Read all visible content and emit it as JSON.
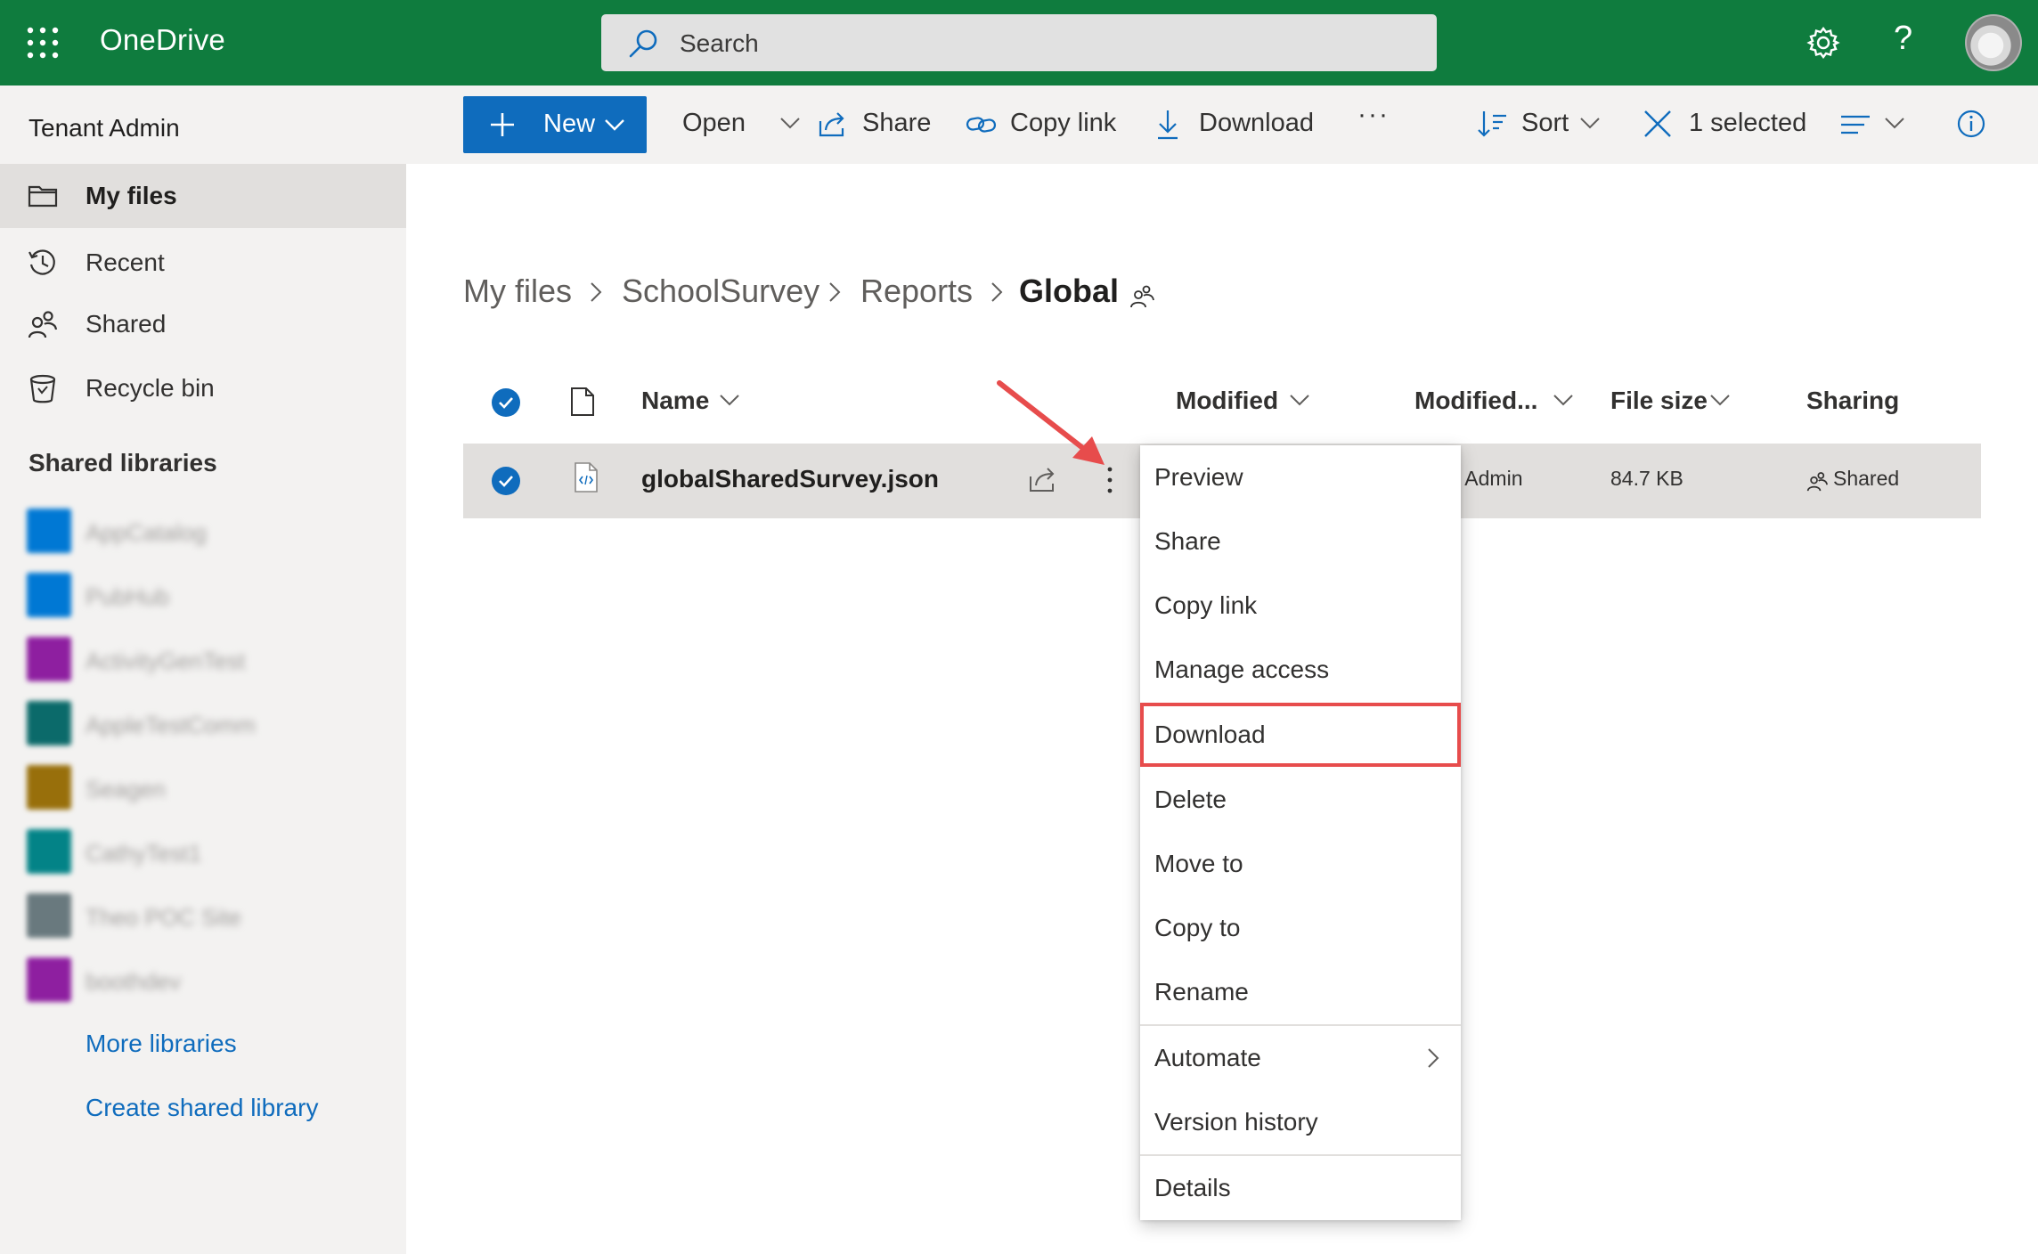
{
  "suite": {
    "app_name": "OneDrive",
    "search_placeholder": "Search"
  },
  "nav": {
    "tenant": "Tenant Admin",
    "items": [
      {
        "label": "My files",
        "icon": "folder-icon",
        "selected": true
      },
      {
        "label": "Recent",
        "icon": "clock-icon",
        "selected": false
      },
      {
        "label": "Shared",
        "icon": "people-icon",
        "selected": false
      },
      {
        "label": "Recycle bin",
        "icon": "trash-icon",
        "selected": false
      }
    ],
    "shared_libraries_heading": "Shared libraries",
    "libraries": [
      {
        "label": "AppCatalog",
        "color": "#0078d4"
      },
      {
        "label": "PubHub",
        "color": "#0078d4"
      },
      {
        "label": "ActivityGenTest",
        "color": "#8e1fa0"
      },
      {
        "label": "AppleTestComm",
        "color": "#0b6a6a"
      },
      {
        "label": "Seagen",
        "color": "#986f0b"
      },
      {
        "label": "CathyTest1",
        "color": "#038387"
      },
      {
        "label": "Theo POC Site",
        "color": "#69797e"
      },
      {
        "label": "boothdev",
        "color": "#8e1fa0"
      }
    ],
    "more_libraries": "More libraries",
    "create_library": "Create shared library"
  },
  "commands": {
    "new": "New",
    "open": "Open",
    "share": "Share",
    "copy_link": "Copy link",
    "download": "Download",
    "more": "···",
    "sort": "Sort",
    "selected": "1 selected"
  },
  "breadcrumb": [
    "My files",
    "SchoolSurvey",
    "Reports",
    "Global"
  ],
  "columns": {
    "name": "Name",
    "modified": "Modified",
    "modified_by": "Modified...",
    "file_size": "File size",
    "sharing": "Sharing"
  },
  "file": {
    "name": "globalSharedSurvey.json",
    "modified_by": "nt Admin",
    "size": "84.7 KB",
    "sharing": "Shared"
  },
  "context_menu": {
    "items": [
      "Preview",
      "Share",
      "Copy link",
      "Manage access",
      "Download",
      "Delete",
      "Move to",
      "Copy to",
      "Rename",
      "Automate",
      "Version history",
      "Details"
    ],
    "highlighted": "Download"
  },
  "colors": {
    "suite_bar": "#0f7c3e",
    "accent": "#0f6cbd",
    "highlight_box": "#e74c4c"
  }
}
